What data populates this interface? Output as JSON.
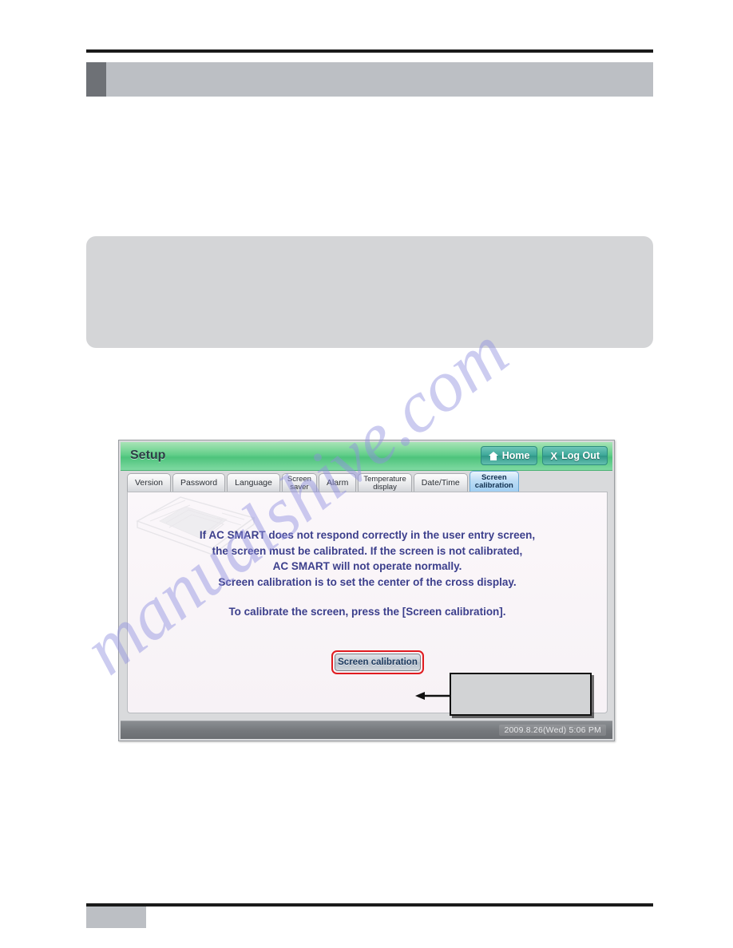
{
  "page": {
    "header_title": "",
    "note_text": "",
    "footer_number": "",
    "watermark": "manualshive.com"
  },
  "device": {
    "title": "Setup",
    "buttons": {
      "home": "Home",
      "logout": "Log Out"
    },
    "tabs": [
      {
        "label": "Version",
        "active": false,
        "two_line": false
      },
      {
        "label": "Password",
        "active": false,
        "two_line": false
      },
      {
        "label": "Language",
        "active": false,
        "two_line": false
      },
      {
        "label": "Screen\nsaver",
        "active": false,
        "two_line": true
      },
      {
        "label": "Alarm",
        "active": false,
        "two_line": false
      },
      {
        "label": "Temperature\ndisplay",
        "active": false,
        "two_line": true
      },
      {
        "label": "Date/Time",
        "active": false,
        "two_line": false
      },
      {
        "label": "Screen\ncalibration",
        "active": true,
        "two_line": true
      }
    ],
    "message": "If AC SMART does not respond correctly in the user entry screen,\nthe screen must be calibrated. If the screen is not calibrated,\nAC SMART will not operate normally.\nScreen calibration is to set the center of the cross display.",
    "message_2": "To calibrate the screen, press the [Screen calibration].",
    "calibration_button": "Screen calibration",
    "timestamp": "2009.8.26(Wed)  5:06 PM"
  },
  "annotation": {
    "callout_text": ""
  }
}
